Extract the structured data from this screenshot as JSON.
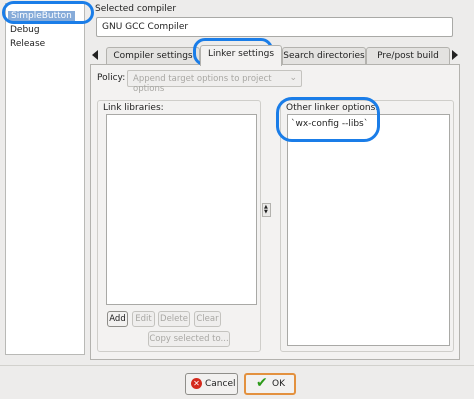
{
  "targets": {
    "items": [
      "SimpleButton",
      "Debug",
      "Release"
    ],
    "selected": "SimpleButton"
  },
  "compiler": {
    "label": "Selected compiler",
    "value": "GNU GCC Compiler"
  },
  "tabs": [
    {
      "label": "Compiler settings",
      "active": false
    },
    {
      "label": "Linker settings",
      "active": true
    },
    {
      "label": "Search directories",
      "active": false
    },
    {
      "label": "Pre/post build steps",
      "active": false
    }
  ],
  "policy": {
    "label": "Policy:",
    "value": "Append target options to project options"
  },
  "link_libraries": {
    "label": "Link libraries:",
    "buttons": {
      "add": "Add",
      "edit": "Edit",
      "delete": "Delete",
      "clear": "Clear",
      "copy": "Copy selected to..."
    }
  },
  "other_options": {
    "label": "Other linker options:",
    "value": "`wx-config --libs`"
  },
  "footer": {
    "cancel": "Cancel",
    "ok": "OK"
  },
  "colors": {
    "annotation": "#1a7de8",
    "selection": "#86abd9"
  }
}
